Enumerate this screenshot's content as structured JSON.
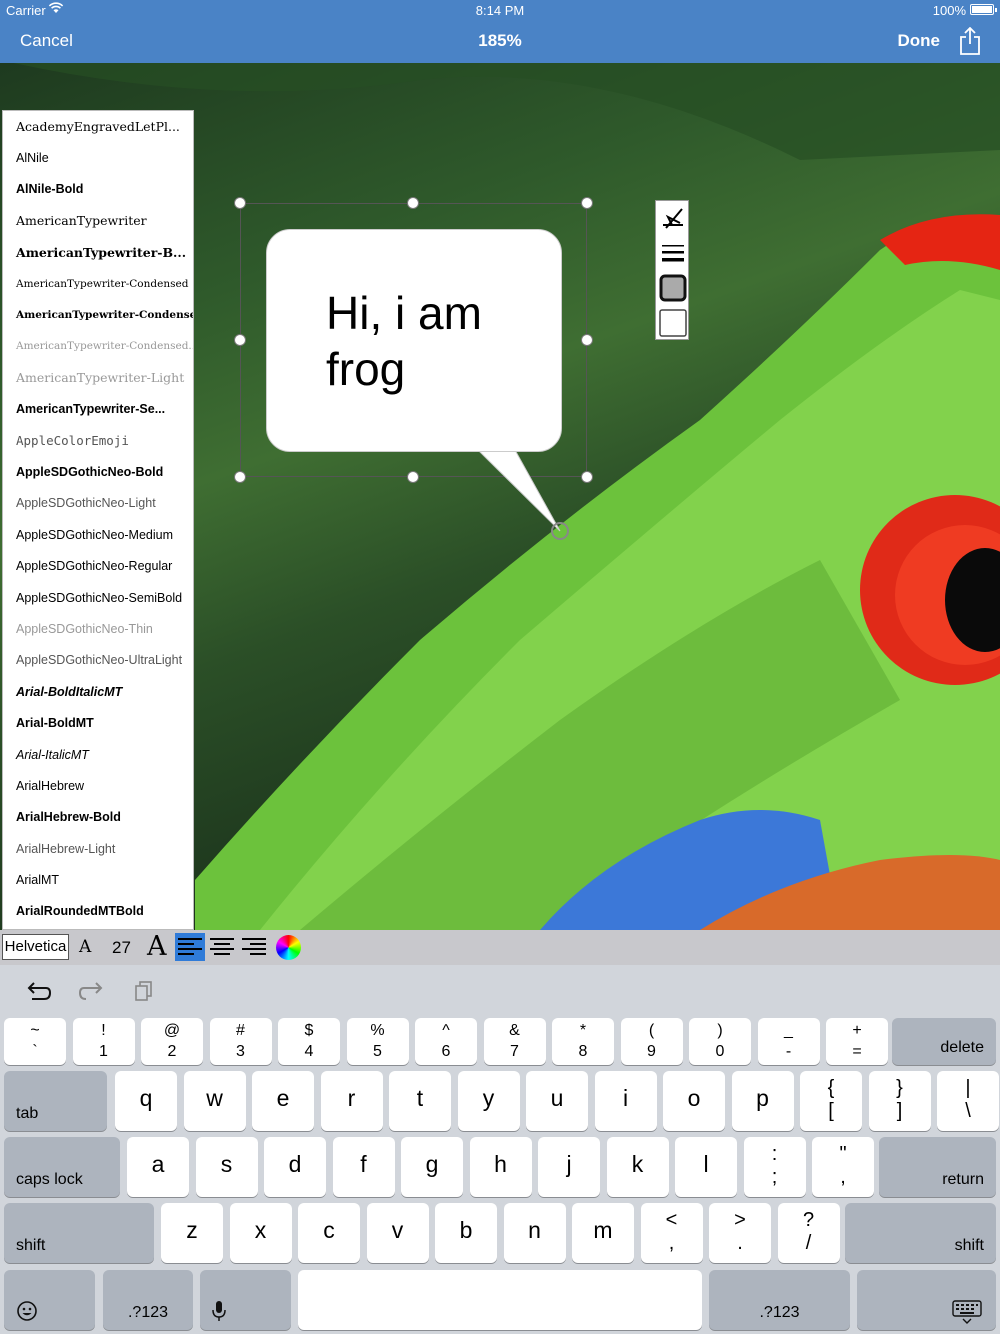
{
  "status": {
    "carrier": "Carrier",
    "time": "8:14 PM",
    "battery": "100%"
  },
  "nav": {
    "cancel": "Cancel",
    "title": "185%",
    "done": "Done",
    "share_icon": "share-icon"
  },
  "font_list": [
    {
      "label": "AcademyEngravedLetPl...",
      "style": "serif"
    },
    {
      "label": "AlNile",
      "style": "plain"
    },
    {
      "label": "AlNile-Bold",
      "style": "bold"
    },
    {
      "label": "AmericanTypewriter",
      "style": "serif"
    },
    {
      "label": "AmericanTypewriter-B...",
      "style": "serif-bold"
    },
    {
      "label": "AmericanTypewriter-Condensed",
      "style": "serif-small"
    },
    {
      "label": "AmericanTypewriter-Condense...",
      "style": "serif-bold-small"
    },
    {
      "label": "AmericanTypewriter-Condensed...",
      "style": "serif-thin-small"
    },
    {
      "label": "AmericanTypewriter-Light",
      "style": "serif-thin"
    },
    {
      "label": "AmericanTypewriter-Se...",
      "style": "bold"
    },
    {
      "label": "AppleColorEmoji",
      "style": "mono"
    },
    {
      "label": "AppleSDGothicNeo-Bold",
      "style": "bold"
    },
    {
      "label": "AppleSDGothicNeo-Light",
      "style": "light"
    },
    {
      "label": "AppleSDGothicNeo-Medium",
      "style": "plain"
    },
    {
      "label": "AppleSDGothicNeo-Regular",
      "style": "plain"
    },
    {
      "label": "AppleSDGothicNeo-SemiBold",
      "style": "plain"
    },
    {
      "label": "AppleSDGothicNeo-Thin",
      "style": "thin"
    },
    {
      "label": "AppleSDGothicNeo-UltraLight",
      "style": "light"
    },
    {
      "label": "Arial-BoldItalicMT",
      "style": "bold-italic"
    },
    {
      "label": "Arial-BoldMT",
      "style": "bold"
    },
    {
      "label": "Arial-ItalicMT",
      "style": "italic"
    },
    {
      "label": "ArialHebrew",
      "style": "plain"
    },
    {
      "label": "ArialHebrew-Bold",
      "style": "bold"
    },
    {
      "label": "ArialHebrew-Light",
      "style": "light"
    },
    {
      "label": "ArialMT",
      "style": "plain"
    },
    {
      "label": "ArialRoundedMTBold",
      "style": "bold"
    }
  ],
  "bubble": {
    "text": "Hi, i am frog"
  },
  "style_toolbar": {
    "icons": [
      "pen-icon",
      "line-weight-icon",
      "fill-icon",
      "outline-icon"
    ]
  },
  "format_bar": {
    "font_name": "Helvetica",
    "smaller": "A",
    "size": "27",
    "larger": "A",
    "alignment": "left",
    "accent": "#2f7bd8"
  },
  "keyboard": {
    "tools": [
      "undo-icon",
      "redo-icon",
      "paste-icon"
    ],
    "rows": [
      [
        [
          "~",
          "`"
        ],
        [
          "!",
          "1"
        ],
        [
          "@",
          "2"
        ],
        [
          "#",
          "3"
        ],
        [
          "$",
          "4"
        ],
        [
          "%",
          "5"
        ],
        [
          "^",
          "6"
        ],
        [
          "&",
          "7"
        ],
        [
          "*",
          "8"
        ],
        [
          "(",
          "9"
        ],
        [
          ")",
          "0"
        ],
        [
          "_",
          "-"
        ],
        [
          "+",
          "="
        ]
      ],
      [
        [
          "",
          "q"
        ],
        [
          "",
          "w"
        ],
        [
          "",
          "e"
        ],
        [
          "",
          "r"
        ],
        [
          "",
          "t"
        ],
        [
          "",
          "y"
        ],
        [
          "",
          "u"
        ],
        [
          "",
          "i"
        ],
        [
          "",
          "o"
        ],
        [
          "",
          "p"
        ],
        [
          "{",
          "["
        ],
        [
          "}",
          "]"
        ],
        [
          "|",
          "\\"
        ]
      ],
      [
        [
          "",
          "a"
        ],
        [
          "",
          "s"
        ],
        [
          "",
          "d"
        ],
        [
          "",
          "f"
        ],
        [
          "",
          "g"
        ],
        [
          "",
          "h"
        ],
        [
          "",
          "j"
        ],
        [
          "",
          "k"
        ],
        [
          "",
          "l"
        ],
        [
          ":",
          ";"
        ],
        [
          "\"",
          ","
        ]
      ],
      [
        [
          "",
          "z"
        ],
        [
          "",
          "x"
        ],
        [
          "",
          "c"
        ],
        [
          "",
          "v"
        ],
        [
          "",
          "b"
        ],
        [
          "",
          "n"
        ],
        [
          "",
          "m"
        ],
        [
          "<",
          ","
        ],
        [
          ">",
          "."
        ],
        [
          "?",
          "/"
        ]
      ]
    ],
    "delete": "delete",
    "tab": "tab",
    "caps_lock": "caps lock",
    "return": "return",
    "shift_left": "shift",
    "shift_right": "shift",
    "numbers_left": ".?123",
    "numbers_right": ".?123",
    "emoji_icon": "emoji-icon",
    "mic_icon": "microphone-icon",
    "hide_icon": "keyboard-hide-icon"
  }
}
